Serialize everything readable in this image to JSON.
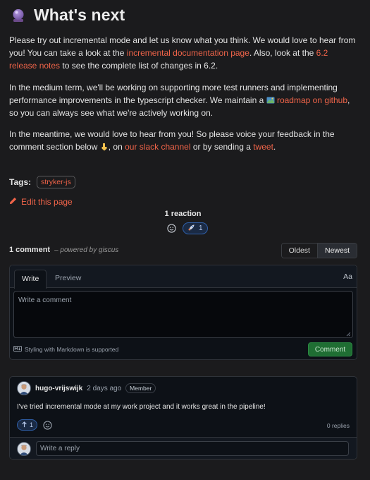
{
  "article": {
    "heading": "What's next",
    "heading_icon": "crystal-ball-icon",
    "p1_a": "Please try out incremental mode and let us know what you think. We would love to hear from you! You can take a look at the ",
    "p1_link1": "incremental documentation page",
    "p1_b": ". Also, look at the ",
    "p1_link2": "6.2 release notes",
    "p1_c": " to see the complete list of changes in 6.2.",
    "p2_a": "In the medium term, we'll be working on supporting more test runners and implementing performance improvements in the typescript checker. We maintain a ",
    "p2_link": "roadmap on github",
    "p2_b": ", so you can always see what we're actively working on.",
    "p3_a": "In the meantime, we would love to hear from you! So please voice your feedback in the comment section below ",
    "p3_b": ", on ",
    "p3_link1": "our slack channel",
    "p3_c": " or by sending a ",
    "p3_link2": "tweet",
    "p3_d": "."
  },
  "tags": {
    "label": "Tags:",
    "items": [
      "stryker-js"
    ]
  },
  "edit": {
    "label": "Edit this page"
  },
  "reactions": {
    "title": "1 reaction",
    "pill_count": "1"
  },
  "comments": {
    "count_label": "1 comment",
    "powered_prefix": "– powered by ",
    "powered_name": "giscus",
    "sort_options": [
      "Oldest",
      "Newest"
    ],
    "active_sort": "Newest"
  },
  "composer": {
    "tab_write": "Write",
    "tab_preview": "Preview",
    "aa": "Aa",
    "placeholder": "Write a comment",
    "markdown_note": "Styling with Markdown is supported",
    "submit": "Comment"
  },
  "thread": {
    "author": "hugo-vrijswijk",
    "time": "2 days ago",
    "badge": "Member",
    "body": "I've tried incremental mode at my work project and it works great in the pipeline!",
    "upvotes": "1",
    "replies": "0 replies",
    "reply_placeholder": "Write a reply"
  },
  "colors": {
    "link": "#f06449",
    "background": "#1b1b1d",
    "panel": "#0d1117",
    "comment_button": "#1f6e33",
    "reaction_accent": "#2f5fa8"
  }
}
